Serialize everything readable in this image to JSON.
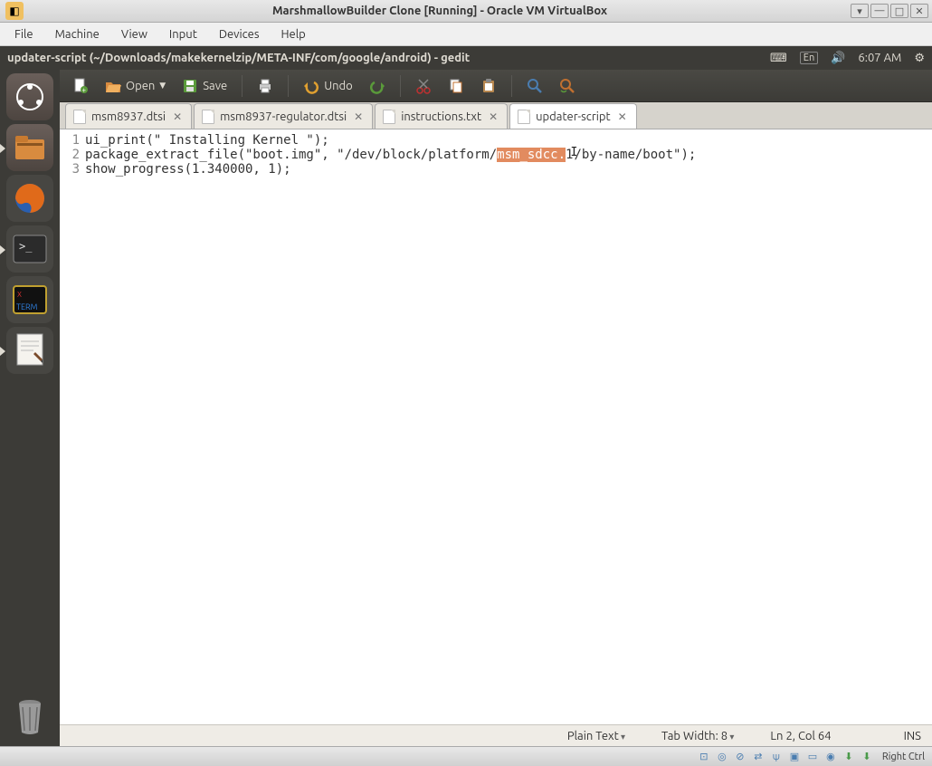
{
  "vm": {
    "title": "MarshmallowBuilder Clone [Running] - Oracle VM VirtualBox",
    "menu": [
      "File",
      "Machine",
      "View",
      "Input",
      "Devices",
      "Help"
    ],
    "host_key": "Right Ctrl"
  },
  "ubuntu": {
    "window_title": "updater-script (~/Downloads/makekernelzip/META-INF/com/google/android) - gedit",
    "lang": "En",
    "time": "6:07 AM"
  },
  "launcher": {
    "items": [
      "dash-home",
      "files",
      "firefox",
      "terminal",
      "xterm",
      "text-editor"
    ]
  },
  "toolbar": {
    "open_label": "Open",
    "save_label": "Save",
    "undo_label": "Undo"
  },
  "tabs": [
    {
      "label": "msm8937.dtsi",
      "active": false
    },
    {
      "label": "msm8937-regulator.dtsi",
      "active": false
    },
    {
      "label": "instructions.txt",
      "active": false
    },
    {
      "label": "updater-script",
      "active": true
    }
  ],
  "code": {
    "l1": "ui_print(\" Installing Kernel \");",
    "l2_pre": "package_extract_file(\"boot.img\", \"/dev/block/platform/",
    "l2_sel": "msm_sdcc.",
    "l2_mid": "1",
    "l2_post": "/by-name/boot\");",
    "l3": "show_progress(1.340000, 1);"
  },
  "status": {
    "lang": "Plain Text",
    "tabwidth": "Tab Width: 8",
    "pos": "Ln 2, Col 64",
    "ins": "INS"
  }
}
